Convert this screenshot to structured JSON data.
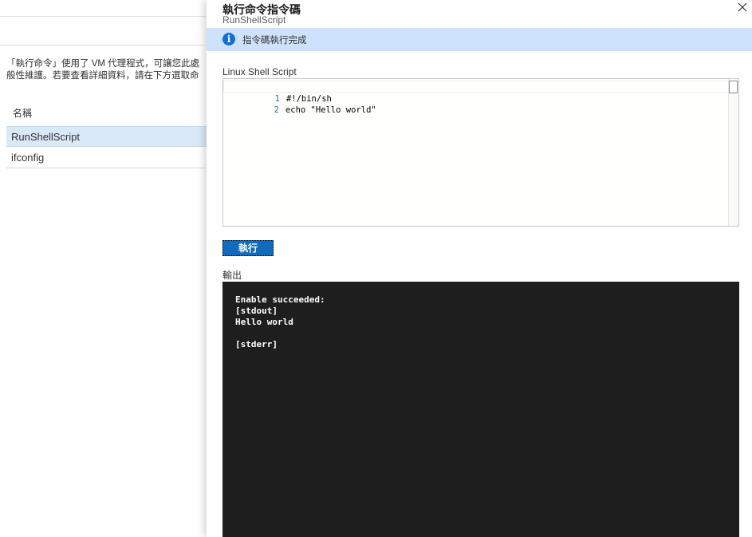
{
  "left_panel": {
    "description_line1": "「執行命令」使用了 VM 代理程式，可讓您此處",
    "description_line2": "般性維護。若要查看詳細資料，請在下方選取命",
    "column_header": "名稱",
    "commands": [
      {
        "name": "RunShellScript",
        "selected": true
      },
      {
        "name": "ifconfig",
        "selected": false
      }
    ]
  },
  "blade": {
    "title": "執行命令指令碼",
    "subtitle": "RunShellScript",
    "close_icon": "close-icon",
    "info_icon": "info-icon",
    "info_message": "指令碼執行完成",
    "script_label": "Linux Shell Script",
    "script_lines": [
      {
        "number": "1",
        "code": "#!/bin/sh"
      },
      {
        "number": "2",
        "code": "echo \"Hello world\""
      }
    ],
    "run_button_label": "執行",
    "output_label": "輸出",
    "output_lines": [
      "Enable succeeded:",
      "[stdout]",
      "Hello world",
      "",
      "[stderr]"
    ]
  },
  "colors": {
    "accent": "#0f6cbd",
    "info_bar": "#cfe2fb",
    "selected_row": "#d9e9f7",
    "output_bg": "#1e1e1e"
  }
}
